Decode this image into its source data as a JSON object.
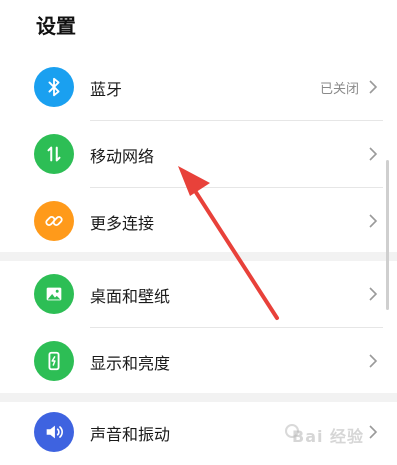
{
  "page": {
    "title": "设置"
  },
  "settings": {
    "group1": [
      {
        "label": "蓝牙",
        "value": "已关闭",
        "icon": "bluetooth-icon",
        "color": "#1AA0F0"
      },
      {
        "label": "移动网络",
        "value": "",
        "icon": "mobile-data-icon",
        "color": "#2DBE55"
      },
      {
        "label": "更多连接",
        "value": "",
        "icon": "link-icon",
        "color": "#FF9A1A"
      }
    ],
    "group2": [
      {
        "label": "桌面和壁纸",
        "value": "",
        "icon": "wallpaper-icon",
        "color": "#2DBE55"
      },
      {
        "label": "显示和亮度",
        "value": "",
        "icon": "display-brightness-icon",
        "color": "#2DBE55"
      }
    ],
    "group3": [
      {
        "label": "声音和振动",
        "value": "",
        "icon": "sound-icon",
        "color": "#3E63E0"
      }
    ]
  },
  "annotation": {
    "arrow_color": "#E8413A"
  },
  "watermark": {
    "text": "Bai 经验"
  }
}
